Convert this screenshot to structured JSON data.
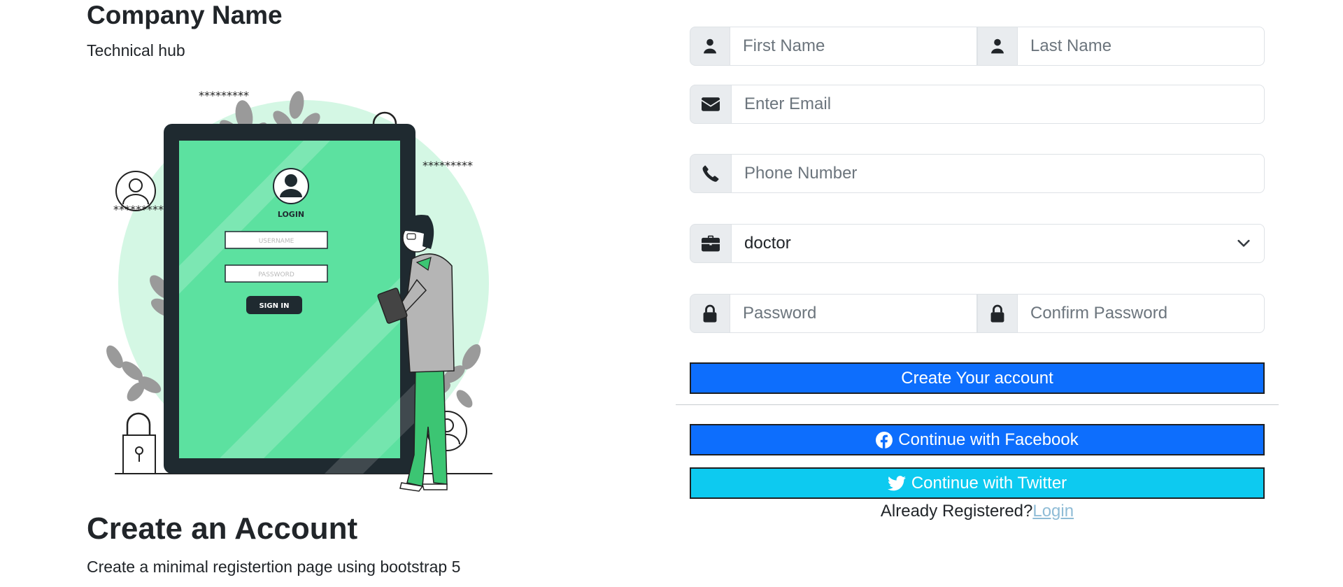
{
  "left": {
    "company_name": "Company Name",
    "tagline": "Technical hub",
    "illustration": {
      "masked_1": "*********",
      "masked_2": "*********",
      "masked_3": "*********",
      "screen_title": "LOGIN",
      "username_placeholder": "USERNAME",
      "password_placeholder": "PASSWORD",
      "signin_label": "SIGN IN"
    },
    "title": "Create an Account",
    "description": "Create a minimal registertion page using bootstrap 5"
  },
  "form": {
    "first_name_placeholder": "First Name",
    "last_name_placeholder": "Last Name",
    "email_placeholder": "Enter Email",
    "phone_placeholder": "Phone Number",
    "role_selected": "doctor",
    "password_placeholder": "Password",
    "confirm_password_placeholder": "Confirm Password",
    "create_button": "Create Your account",
    "facebook_button": "Continue with Facebook",
    "twitter_button": "Continue with Twitter",
    "already_text": "Already Registered?",
    "login_link": "Login"
  },
  "colors": {
    "primary": "#0d6efd",
    "info": "#0dcaf0",
    "addon_bg": "#e9ecef",
    "illustration_green": "#5ce1a0",
    "illustration_mint": "#d4f7e4",
    "illustration_dark": "#1f2a30"
  }
}
